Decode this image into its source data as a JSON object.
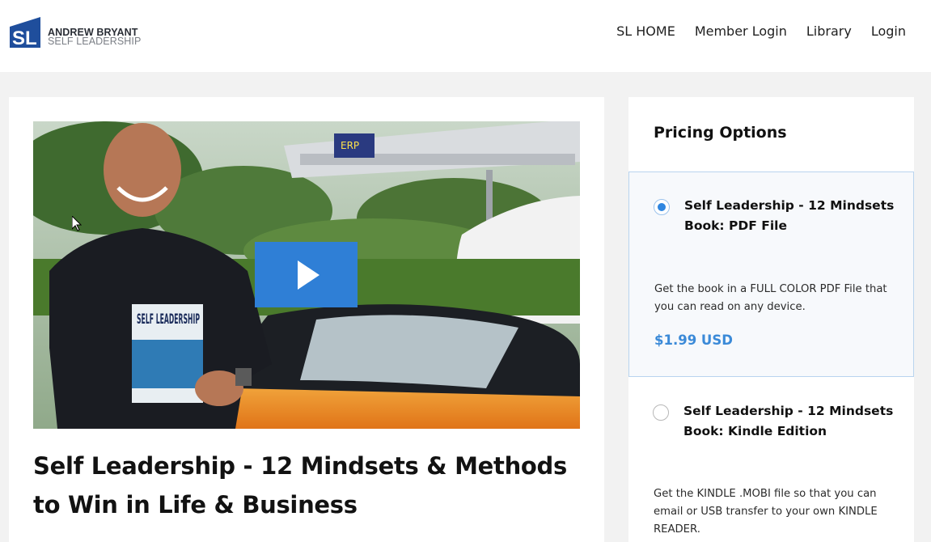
{
  "header": {
    "logo": {
      "mark": "SL",
      "name": "ANDREW BRYANT",
      "tagline": "SELF LEADERSHIP"
    },
    "nav": [
      "SL HOME",
      "Member Login",
      "Library",
      "Login"
    ]
  },
  "video": {
    "book_cover_text": "SELF LEADERSHIP",
    "sign_text": "ERP"
  },
  "course": {
    "title": "Self Leadership - 12 Mindsets & Methods to Win in Life & Business"
  },
  "pricing": {
    "title": "Pricing Options",
    "options": [
      {
        "name": "Self Leadership - 12 Mindsets Book: PDF File",
        "description": "Get the book in a FULL COLOR PDF File that you can read on any device.",
        "price": "$1.99 USD",
        "selected": true
      },
      {
        "name": "Self Leadership - 12 Mindsets Book: Kindle Edition",
        "description": "Get the KINDLE .MOBI file so that you can email or USB transfer to your own KINDLE READER.",
        "selected": false
      }
    ]
  },
  "colors": {
    "accent": "#2f7fd6",
    "price": "#3b8ad8",
    "logo_blue": "#1f4e9c",
    "selected_border": "#b9d4ef"
  }
}
